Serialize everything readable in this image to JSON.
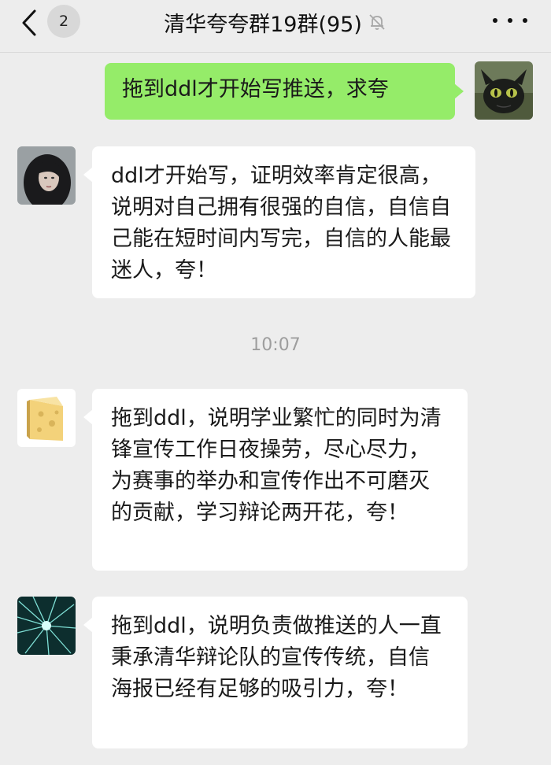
{
  "header": {
    "unread_count": "2",
    "title": "清华夸夸群19群(95)"
  },
  "messages": [
    {
      "id": "m1",
      "direction": "out",
      "text": "拖到ddl才开始写推送，求夸",
      "avatar": "dragon-avatar"
    },
    {
      "id": "m2",
      "direction": "in",
      "text": "ddl才开始写，证明效率肯定很高，说明对自己拥有很强的自信，自信自己能在短时间内写完，自信的人能最迷人，夸！",
      "avatar": "girl-avatar"
    },
    {
      "id": "m3",
      "direction": "in",
      "text": "拖到ddl，说明学业繁忙的同时为清锋宣传工作日夜操劳，尽心尽力，为赛事的举办和宣传作出不可磨灭的贡献，学习辩论两开花，夸！",
      "avatar": "cheese-avatar"
    },
    {
      "id": "m4",
      "direction": "in",
      "text": "拖到ddl，说明负责做推送的人一直秉承清华辩论队的宣传传统，自信海报已经有足够的吸引力，夸！",
      "avatar": "starburst-avatar"
    }
  ],
  "timestamp": "10:07",
  "colors": {
    "background": "#ededed",
    "outgoing_bubble": "#95ec69",
    "incoming_bubble": "#ffffff",
    "timestamp_text": "#9e9e9e"
  }
}
